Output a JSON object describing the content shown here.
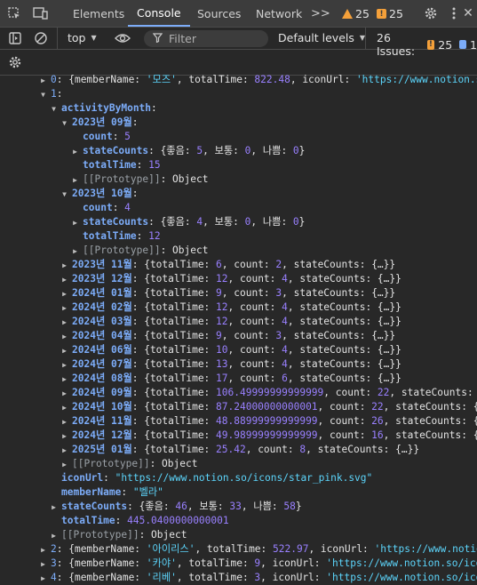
{
  "tabbar": {
    "tabs": [
      "Elements",
      "Console",
      "Sources",
      "Network"
    ],
    "more": ">>",
    "warnings_count": "25",
    "issues_count": "25"
  },
  "toolbar": {
    "context": "top",
    "filter_placeholder": "Filter",
    "levels": "Default levels",
    "issues_label": "26 Issues:",
    "issues_warn": "25",
    "issues_info": "1"
  },
  "colors": {
    "key": "#7cacf8",
    "number": "#9980ff",
    "string": "#5cd5fb",
    "accent": "#7cacf8",
    "warning": "#f4a03a"
  },
  "console_lines": [
    {
      "indent": 44,
      "caret": "▶",
      "parts": [
        [
          "k",
          "0"
        ],
        [
          "punc",
          ": {memberName: "
        ],
        [
          "str",
          "'모즈'"
        ],
        [
          "punc",
          ", totalTime: "
        ],
        [
          "num",
          "822.48"
        ],
        [
          "punc",
          ", iconUrl: "
        ],
        [
          "str",
          "'https://www.notion.so/i"
        ]
      ]
    },
    {
      "indent": 44,
      "caret": "▼",
      "parts": [
        [
          "k",
          "1"
        ],
        [
          "punc",
          ":"
        ]
      ]
    },
    {
      "indent": 56,
      "caret": "▼",
      "parts": [
        [
          "kb",
          "activityByMonth"
        ],
        [
          "punc",
          ":"
        ]
      ]
    },
    {
      "indent": 68,
      "caret": "▼",
      "parts": [
        [
          "kb",
          "2023년 09월"
        ],
        [
          "punc",
          ":"
        ]
      ]
    },
    {
      "indent": 80,
      "caret": "",
      "parts": [
        [
          "kb",
          "count"
        ],
        [
          "punc",
          ": "
        ],
        [
          "num",
          "5"
        ]
      ]
    },
    {
      "indent": 80,
      "caret": "▶",
      "parts": [
        [
          "kb",
          "stateCounts"
        ],
        [
          "punc",
          ": {좋음: "
        ],
        [
          "num",
          "5"
        ],
        [
          "punc",
          ", 보통: "
        ],
        [
          "num",
          "0"
        ],
        [
          "punc",
          ", 나쁨: "
        ],
        [
          "num",
          "0"
        ],
        [
          "punc",
          "}"
        ]
      ]
    },
    {
      "indent": 80,
      "caret": "",
      "parts": [
        [
          "kb",
          "totalTime"
        ],
        [
          "punc",
          ": "
        ],
        [
          "num",
          "15"
        ]
      ]
    },
    {
      "indent": 80,
      "caret": "▶",
      "parts": [
        [
          "kd",
          "[[Prototype]]"
        ],
        [
          "punc",
          ": Object"
        ]
      ]
    },
    {
      "indent": 68,
      "caret": "▼",
      "parts": [
        [
          "kb",
          "2023년 10월"
        ],
        [
          "punc",
          ":"
        ]
      ]
    },
    {
      "indent": 80,
      "caret": "",
      "parts": [
        [
          "kb",
          "count"
        ],
        [
          "punc",
          ": "
        ],
        [
          "num",
          "4"
        ]
      ]
    },
    {
      "indent": 80,
      "caret": "▶",
      "parts": [
        [
          "kb",
          "stateCounts"
        ],
        [
          "punc",
          ": {좋음: "
        ],
        [
          "num",
          "4"
        ],
        [
          "punc",
          ", 보통: "
        ],
        [
          "num",
          "0"
        ],
        [
          "punc",
          ", 나쁨: "
        ],
        [
          "num",
          "0"
        ],
        [
          "punc",
          "}"
        ]
      ]
    },
    {
      "indent": 80,
      "caret": "",
      "parts": [
        [
          "kb",
          "totalTime"
        ],
        [
          "punc",
          ": "
        ],
        [
          "num",
          "12"
        ]
      ]
    },
    {
      "indent": 80,
      "caret": "▶",
      "parts": [
        [
          "kd",
          "[[Prototype]]"
        ],
        [
          "punc",
          ": Object"
        ]
      ]
    },
    {
      "indent": 68,
      "caret": "▶",
      "parts": [
        [
          "kb",
          "2023년 11월"
        ],
        [
          "punc",
          ": {totalTime: "
        ],
        [
          "num",
          "6"
        ],
        [
          "punc",
          ", count: "
        ],
        [
          "num",
          "2"
        ],
        [
          "punc",
          ", stateCounts: {…}}"
        ]
      ]
    },
    {
      "indent": 68,
      "caret": "▶",
      "parts": [
        [
          "kb",
          "2023년 12월"
        ],
        [
          "punc",
          ": {totalTime: "
        ],
        [
          "num",
          "12"
        ],
        [
          "punc",
          ", count: "
        ],
        [
          "num",
          "4"
        ],
        [
          "punc",
          ", stateCounts: {…}}"
        ]
      ]
    },
    {
      "indent": 68,
      "caret": "▶",
      "parts": [
        [
          "kb",
          "2024년 01월"
        ],
        [
          "punc",
          ": {totalTime: "
        ],
        [
          "num",
          "9"
        ],
        [
          "punc",
          ", count: "
        ],
        [
          "num",
          "3"
        ],
        [
          "punc",
          ", stateCounts: {…}}"
        ]
      ]
    },
    {
      "indent": 68,
      "caret": "▶",
      "parts": [
        [
          "kb",
          "2024년 02월"
        ],
        [
          "punc",
          ": {totalTime: "
        ],
        [
          "num",
          "12"
        ],
        [
          "punc",
          ", count: "
        ],
        [
          "num",
          "4"
        ],
        [
          "punc",
          ", stateCounts: {…}}"
        ]
      ]
    },
    {
      "indent": 68,
      "caret": "▶",
      "parts": [
        [
          "kb",
          "2024년 03월"
        ],
        [
          "punc",
          ": {totalTime: "
        ],
        [
          "num",
          "12"
        ],
        [
          "punc",
          ", count: "
        ],
        [
          "num",
          "4"
        ],
        [
          "punc",
          ", stateCounts: {…}}"
        ]
      ]
    },
    {
      "indent": 68,
      "caret": "▶",
      "parts": [
        [
          "kb",
          "2024년 04월"
        ],
        [
          "punc",
          ": {totalTime: "
        ],
        [
          "num",
          "9"
        ],
        [
          "punc",
          ", count: "
        ],
        [
          "num",
          "3"
        ],
        [
          "punc",
          ", stateCounts: {…}}"
        ]
      ]
    },
    {
      "indent": 68,
      "caret": "▶",
      "parts": [
        [
          "kb",
          "2024년 06월"
        ],
        [
          "punc",
          ": {totalTime: "
        ],
        [
          "num",
          "10"
        ],
        [
          "punc",
          ", count: "
        ],
        [
          "num",
          "4"
        ],
        [
          "punc",
          ", stateCounts: {…}}"
        ]
      ]
    },
    {
      "indent": 68,
      "caret": "▶",
      "parts": [
        [
          "kb",
          "2024년 07월"
        ],
        [
          "punc",
          ": {totalTime: "
        ],
        [
          "num",
          "13"
        ],
        [
          "punc",
          ", count: "
        ],
        [
          "num",
          "4"
        ],
        [
          "punc",
          ", stateCounts: {…}}"
        ]
      ]
    },
    {
      "indent": 68,
      "caret": "▶",
      "parts": [
        [
          "kb",
          "2024년 08월"
        ],
        [
          "punc",
          ": {totalTime: "
        ],
        [
          "num",
          "17"
        ],
        [
          "punc",
          ", count: "
        ],
        [
          "num",
          "6"
        ],
        [
          "punc",
          ", stateCounts: {…}}"
        ]
      ]
    },
    {
      "indent": 68,
      "caret": "▶",
      "parts": [
        [
          "kb",
          "2024년 09월"
        ],
        [
          "punc",
          ": {totalTime: "
        ],
        [
          "num",
          "106.49999999999999"
        ],
        [
          "punc",
          ", count: "
        ],
        [
          "num",
          "22"
        ],
        [
          "punc",
          ", stateCounts: {…"
        ]
      ]
    },
    {
      "indent": 68,
      "caret": "▶",
      "parts": [
        [
          "kb",
          "2024년 10월"
        ],
        [
          "punc",
          ": {totalTime: "
        ],
        [
          "num",
          "87.24000000000001"
        ],
        [
          "punc",
          ", count: "
        ],
        [
          "num",
          "22"
        ],
        [
          "punc",
          ", stateCounts: {…"
        ]
      ]
    },
    {
      "indent": 68,
      "caret": "▶",
      "parts": [
        [
          "kb",
          "2024년 11월"
        ],
        [
          "punc",
          ": {totalTime: "
        ],
        [
          "num",
          "48.88999999999999"
        ],
        [
          "punc",
          ", count: "
        ],
        [
          "num",
          "26"
        ],
        [
          "punc",
          ", stateCounts: {…"
        ]
      ]
    },
    {
      "indent": 68,
      "caret": "▶",
      "parts": [
        [
          "kb",
          "2024년 12월"
        ],
        [
          "punc",
          ": {totalTime: "
        ],
        [
          "num",
          "49.98999999999999"
        ],
        [
          "punc",
          ", count: "
        ],
        [
          "num",
          "16"
        ],
        [
          "punc",
          ", stateCounts: {…"
        ]
      ]
    },
    {
      "indent": 68,
      "caret": "▶",
      "parts": [
        [
          "kb",
          "2025년 01월"
        ],
        [
          "punc",
          ": {totalTime: "
        ],
        [
          "num",
          "25.42"
        ],
        [
          "punc",
          ", count: "
        ],
        [
          "num",
          "8"
        ],
        [
          "punc",
          ", stateCounts: {…}}"
        ]
      ]
    },
    {
      "indent": 68,
      "caret": "▶",
      "parts": [
        [
          "kd",
          "[[Prototype]]"
        ],
        [
          "punc",
          ": Object"
        ]
      ]
    },
    {
      "indent": 56,
      "caret": "",
      "parts": [
        [
          "kb",
          "iconUrl"
        ],
        [
          "punc",
          ": "
        ],
        [
          "str",
          "\"https://www.notion.so/icons/star_pink.svg\""
        ]
      ]
    },
    {
      "indent": 56,
      "caret": "",
      "parts": [
        [
          "kb",
          "memberName"
        ],
        [
          "punc",
          ": "
        ],
        [
          "str",
          "\"벨라\""
        ]
      ]
    },
    {
      "indent": 56,
      "caret": "▶",
      "parts": [
        [
          "kb",
          "stateCounts"
        ],
        [
          "punc",
          ": {좋음: "
        ],
        [
          "num",
          "46"
        ],
        [
          "punc",
          ", 보통: "
        ],
        [
          "num",
          "33"
        ],
        [
          "punc",
          ", 나쁨: "
        ],
        [
          "num",
          "58"
        ],
        [
          "punc",
          "}"
        ]
      ]
    },
    {
      "indent": 56,
      "caret": "",
      "parts": [
        [
          "kb",
          "totalTime"
        ],
        [
          "punc",
          ": "
        ],
        [
          "num",
          "445.0400000000001"
        ]
      ]
    },
    {
      "indent": 56,
      "caret": "▶",
      "parts": [
        [
          "kd",
          "[[Prototype]]"
        ],
        [
          "punc",
          ": Object"
        ]
      ]
    },
    {
      "indent": 44,
      "caret": "▶",
      "parts": [
        [
          "k",
          "2"
        ],
        [
          "punc",
          ": {memberName: "
        ],
        [
          "str",
          "'아이리스'"
        ],
        [
          "punc",
          ", totalTime: "
        ],
        [
          "num",
          "522.97"
        ],
        [
          "punc",
          ", iconUrl: "
        ],
        [
          "str",
          "'https://www.notion."
        ]
      ]
    },
    {
      "indent": 44,
      "caret": "▶",
      "parts": [
        [
          "k",
          "3"
        ],
        [
          "punc",
          ": {memberName: "
        ],
        [
          "str",
          "'카야'"
        ],
        [
          "punc",
          ", totalTime: "
        ],
        [
          "num",
          "9"
        ],
        [
          "punc",
          ", iconUrl: "
        ],
        [
          "str",
          "'https://www.notion.so/icons/"
        ]
      ]
    },
    {
      "indent": 44,
      "caret": "▶",
      "parts": [
        [
          "k",
          "4"
        ],
        [
          "punc",
          ": {memberName: "
        ],
        [
          "str",
          "'리베'"
        ],
        [
          "punc",
          ", totalTime: "
        ],
        [
          "num",
          "3"
        ],
        [
          "punc",
          ", iconUrl: "
        ],
        [
          "str",
          "'https://www.notion.so/icons/"
        ]
      ]
    }
  ]
}
